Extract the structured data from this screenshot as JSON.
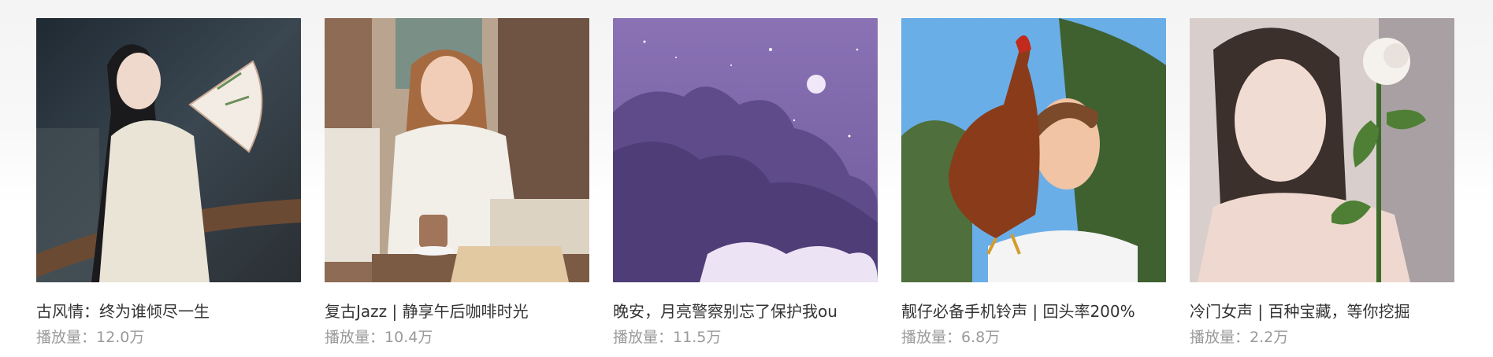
{
  "playlists": [
    {
      "title": "古风情：终为谁倾尽一生",
      "plays_label": "播放量：",
      "plays": "12.0万",
      "cover": "hanfu-woman-fan-image"
    },
    {
      "title": "复古Jazz | 静享午后咖啡时光",
      "plays_label": "播放量：",
      "plays": "10.4万",
      "cover": "woman-coffee-cafe-image"
    },
    {
      "title": "晚安，月亮警察别忘了保护我ou",
      "plays_label": "播放量：",
      "plays": "11.5万",
      "cover": "purple-night-sky-moon-image"
    },
    {
      "title": "靓仔必备手机铃声 | 回头率200%",
      "plays_label": "播放量：",
      "plays": "6.8万",
      "cover": "man-with-hen-image"
    },
    {
      "title": "冷门女声 | 百种宝藏，等你挖掘",
      "plays_label": "播放量：",
      "plays": "2.2万",
      "cover": "woman-white-rose-image"
    }
  ],
  "colors": {
    "title": "#333333",
    "plays": "#9a9a9a"
  }
}
